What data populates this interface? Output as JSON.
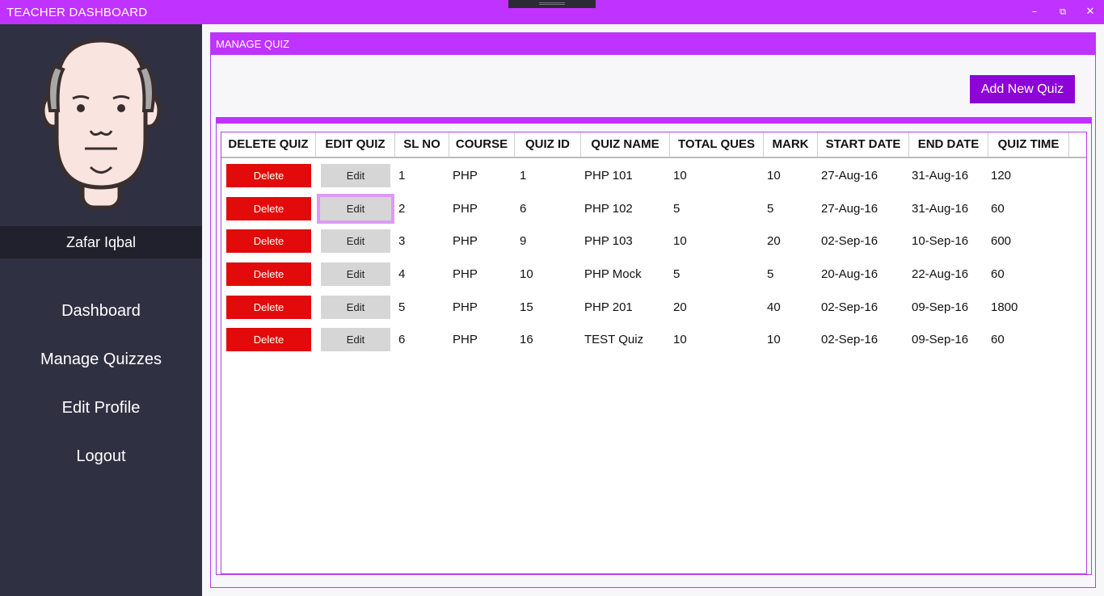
{
  "window": {
    "title": "TEACHER DASHBOARD",
    "minimize_icon": "minimize-icon",
    "restore_icon": "restore-icon",
    "close_icon": "close-icon"
  },
  "sidebar": {
    "user_name": "Zafar Iqbal",
    "nav": [
      {
        "label": "Dashboard"
      },
      {
        "label": "Manage Quizzes"
      },
      {
        "label": "Edit Profile"
      },
      {
        "label": "Logout"
      }
    ]
  },
  "main": {
    "panel_title": "MANAGE QUIZ",
    "add_button": "Add New Quiz",
    "columns": [
      "DELETE QUIZ",
      "EDIT QUIZ",
      "SL NO",
      "COURSE",
      "QUIZ ID",
      "QUIZ NAME",
      "TOTAL QUES",
      "MARK",
      "START DATE",
      "END DATE",
      "QUIZ TIME"
    ],
    "rows": [
      {
        "delete": "Delete",
        "edit": "Edit",
        "sl": "1",
        "course": "PHP",
        "quiz_id": "1",
        "name": "PHP 101",
        "total": "10",
        "mark": "10",
        "start": "27-Aug-16",
        "end": "31-Aug-16",
        "time": "120"
      },
      {
        "delete": "Delete",
        "edit": "Edit",
        "sl": "2",
        "course": "PHP",
        "quiz_id": "6",
        "name": "PHP 102",
        "total": "5",
        "mark": "5",
        "start": "27-Aug-16",
        "end": "31-Aug-16",
        "time": "60"
      },
      {
        "delete": "Delete",
        "edit": "Edit",
        "sl": "3",
        "course": "PHP",
        "quiz_id": "9",
        "name": "PHP 103",
        "total": "10",
        "mark": "20",
        "start": "02-Sep-16",
        "end": "10-Sep-16",
        "time": "600"
      },
      {
        "delete": "Delete",
        "edit": "Edit",
        "sl": "4",
        "course": "PHP",
        "quiz_id": "10",
        "name": "PHP Mock",
        "total": "5",
        "mark": "5",
        "start": "20-Aug-16",
        "end": "22-Aug-16",
        "time": "60"
      },
      {
        "delete": "Delete",
        "edit": "Edit",
        "sl": "5",
        "course": "PHP",
        "quiz_id": "15",
        "name": "PHP 201",
        "total": "20",
        "mark": "40",
        "start": "02-Sep-16",
        "end": "09-Sep-16",
        "time": "1800"
      },
      {
        "delete": "Delete",
        "edit": "Edit",
        "sl": "6",
        "course": "PHP",
        "quiz_id": "16",
        "name": "TEST Quiz",
        "total": "10",
        "mark": "10",
        "start": "02-Sep-16",
        "end": "09-Sep-16",
        "time": "60"
      }
    ]
  },
  "colors": {
    "accent": "#c032ff",
    "button_purple": "#8b06d6",
    "sidebar": "#2f3142",
    "delete": "#e20a0a"
  }
}
